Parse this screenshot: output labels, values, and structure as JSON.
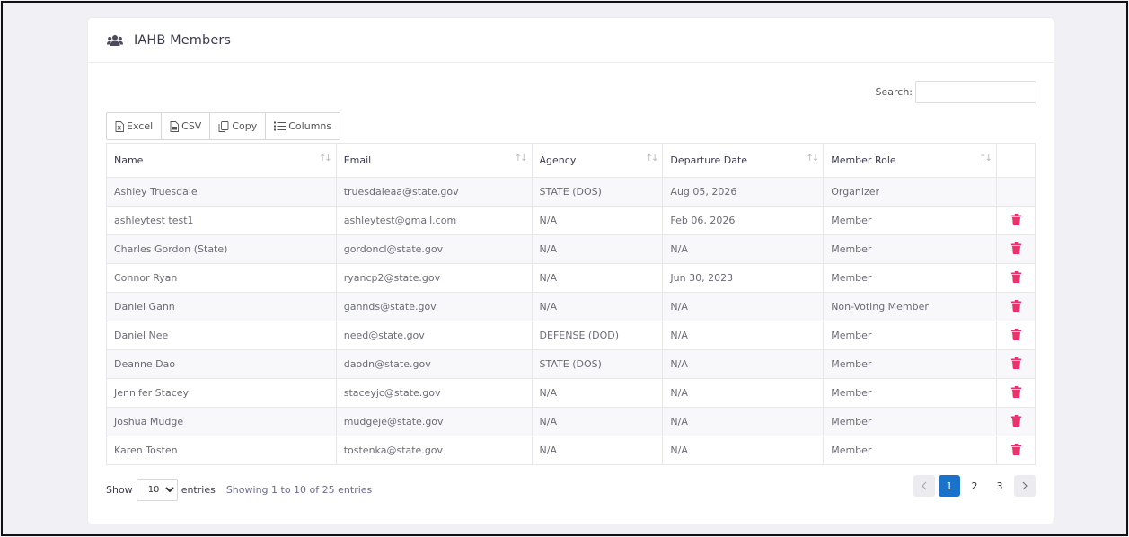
{
  "header": {
    "title": "IAHB Members",
    "icon": "users-icon"
  },
  "search": {
    "label": "Search:",
    "value": "",
    "placeholder": ""
  },
  "toolbar": {
    "excel_label": "Excel",
    "csv_label": "CSV",
    "copy_label": "Copy",
    "columns_label": "Columns"
  },
  "table": {
    "columns": [
      "Name",
      "Email",
      "Agency",
      "Departure Date",
      "Member Role"
    ],
    "rows": [
      {
        "name": "Ashley Truesdale",
        "email": "truesdaleaa@state.gov",
        "agency": "STATE (DOS)",
        "date": "Aug 05, 2026",
        "role": "Organizer"
      },
      {
        "name": "ashleytest test1",
        "email": "ashleytest@gmail.com",
        "agency": "N/A",
        "date": "Feb 06, 2026",
        "role": "Member"
      },
      {
        "name": "Charles Gordon (State)",
        "email": "gordoncl@state.gov",
        "agency": "N/A",
        "date": "N/A",
        "role": "Member"
      },
      {
        "name": "Connor Ryan",
        "email": "ryancp2@state.gov",
        "agency": "N/A",
        "date": "Jun 30, 2023",
        "role": "Member"
      },
      {
        "name": "Daniel Gann",
        "email": "gannds@state.gov",
        "agency": "N/A",
        "date": "N/A",
        "role": "Non-Voting Member"
      },
      {
        "name": "Daniel Nee",
        "email": "need@state.gov",
        "agency": "DEFENSE (DOD)",
        "date": "N/A",
        "role": "Member"
      },
      {
        "name": "Deanne Dao",
        "email": "daodn@state.gov",
        "agency": "STATE (DOS)",
        "date": "N/A",
        "role": "Member"
      },
      {
        "name": "Jennifer Stacey",
        "email": "staceyjc@state.gov",
        "agency": "N/A",
        "date": "N/A",
        "role": "Member"
      },
      {
        "name": "Joshua Mudge",
        "email": "mudgeje@state.gov",
        "agency": "N/A",
        "date": "N/A",
        "role": "Member"
      },
      {
        "name": "Karen Tosten",
        "email": "tostenka@state.gov",
        "agency": "N/A",
        "date": "N/A",
        "role": "Member"
      }
    ],
    "delete_rows": [
      false,
      true,
      true,
      true,
      true,
      true,
      true,
      true,
      true,
      true
    ]
  },
  "footer": {
    "show_label": "Show",
    "entries_value": "10",
    "entries_label": "entries",
    "info": "Showing 1 to 10 of 25 entries"
  },
  "pagination": {
    "pages": [
      "1",
      "2",
      "3"
    ],
    "current": "1"
  },
  "colors": {
    "accent": "#1a73c8",
    "delete": "#e8336d",
    "background": "#f1f1f5"
  }
}
